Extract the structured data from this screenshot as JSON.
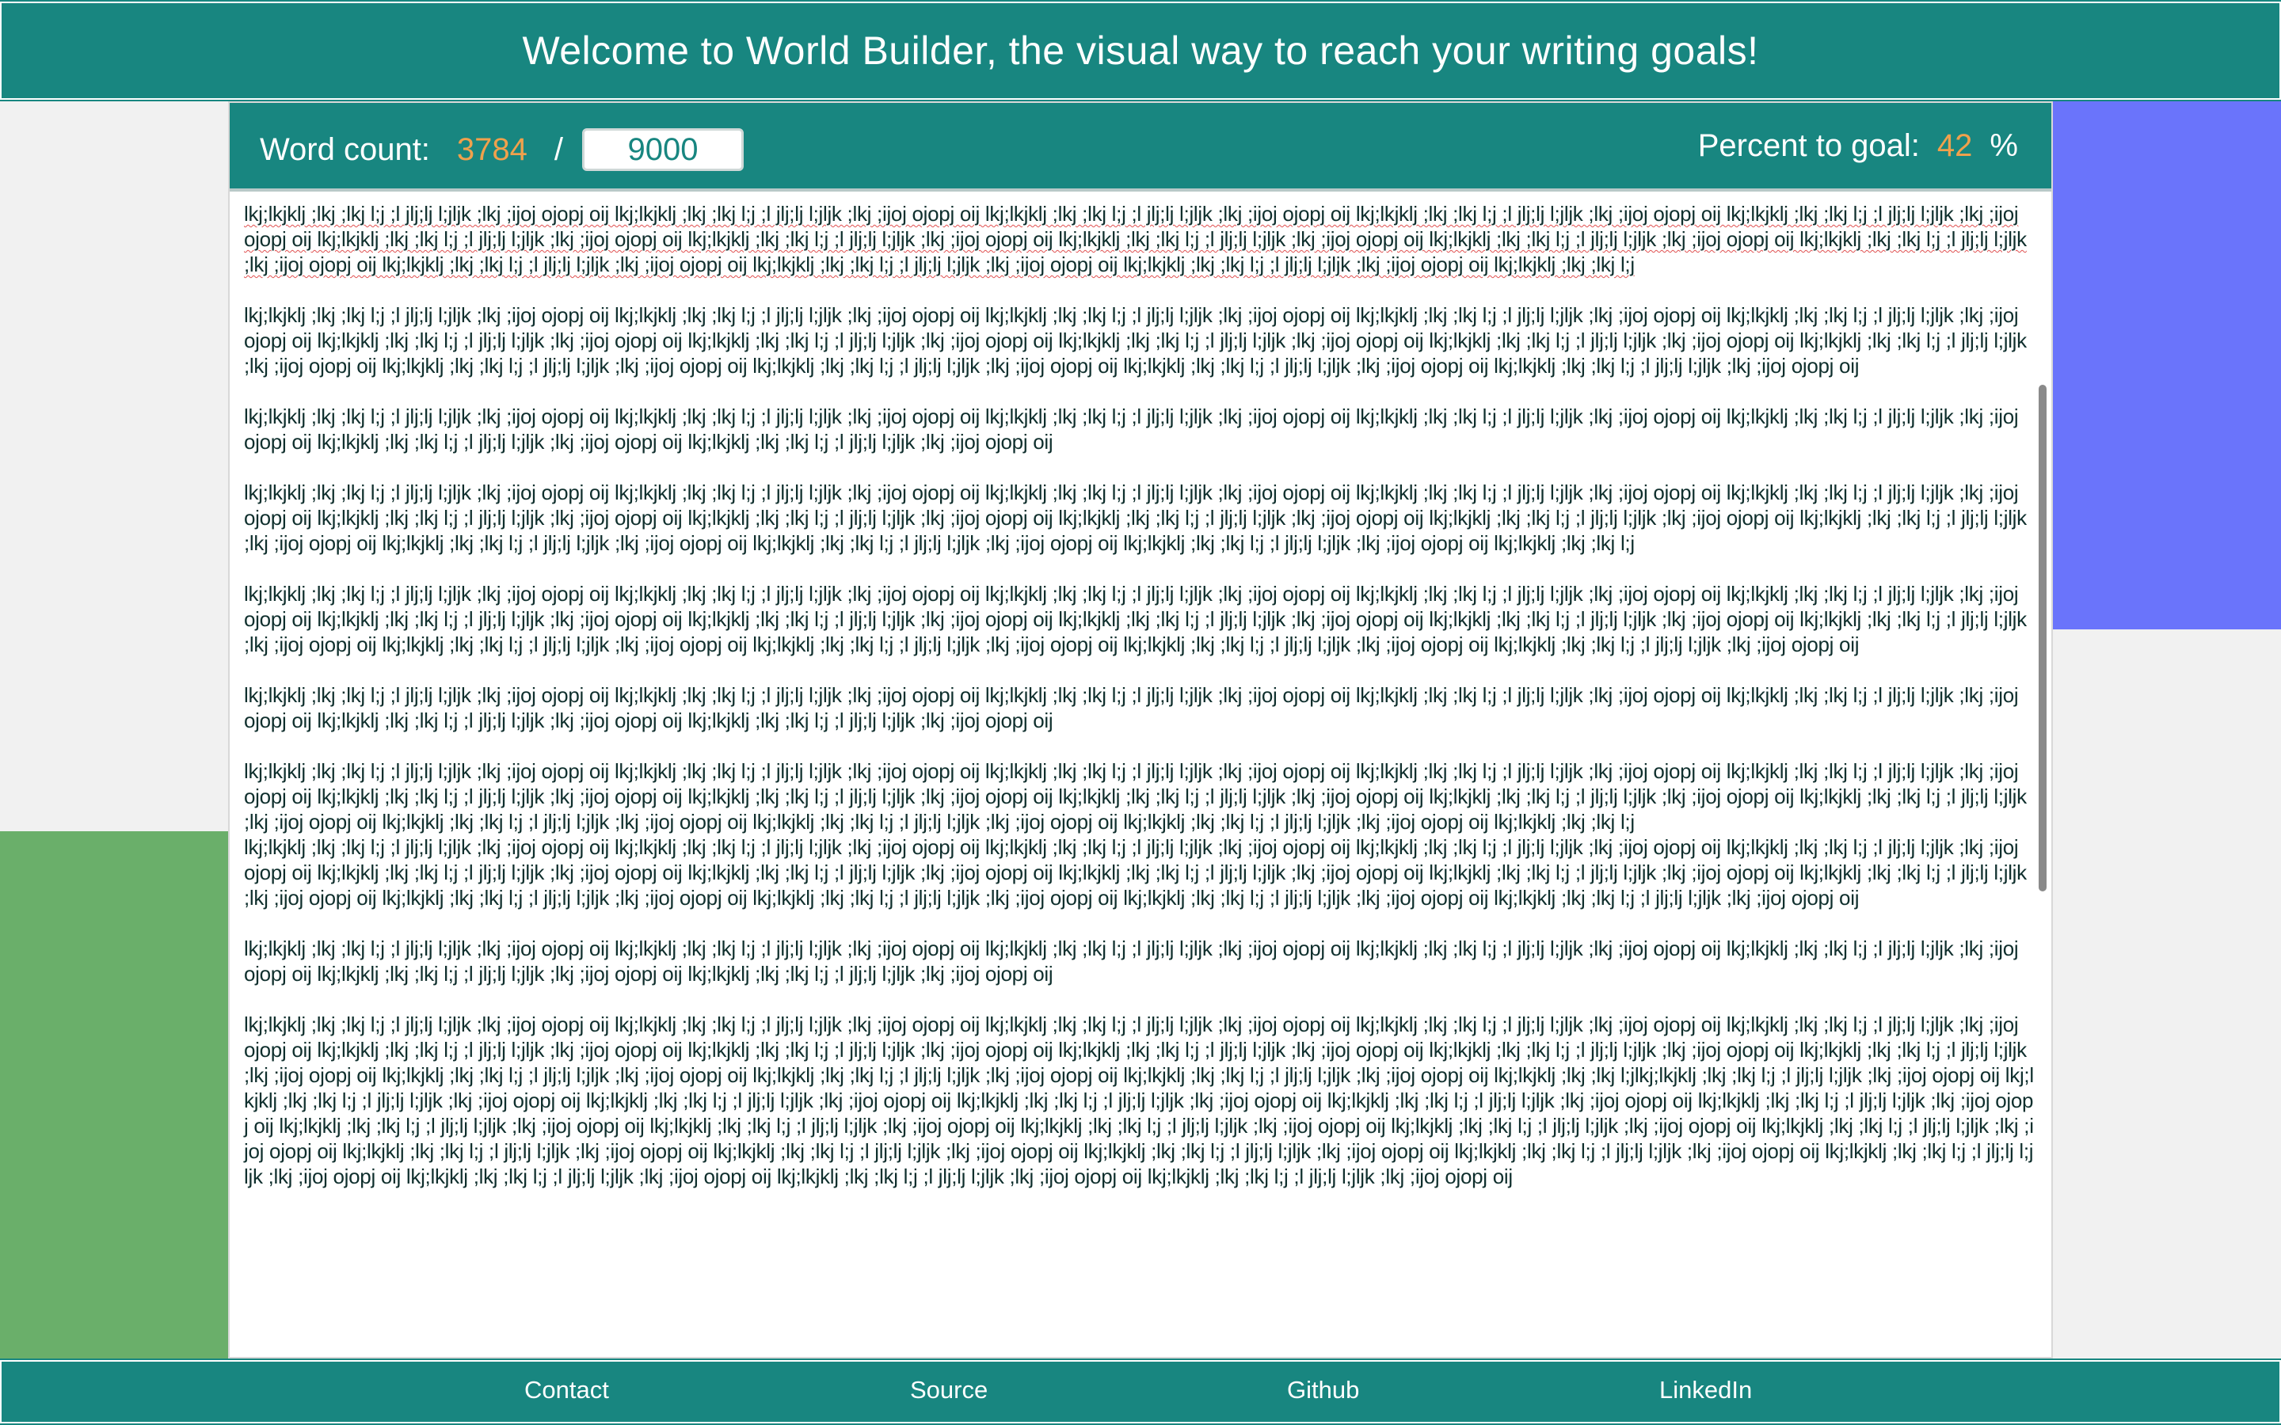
{
  "header": {
    "title": "Welcome to World Builder, the visual way to reach your writing goals!"
  },
  "word_count": {
    "label": "Word count:",
    "current": "3784",
    "separator": "/",
    "goal": "9000",
    "percent_label": "Percent to goal:",
    "percent_value": "42",
    "percent_sign": "%"
  },
  "editor": {
    "paragraphs": [
      "lkj;lkjklj ;lkj ;lkj l;j ;l jlj;lj l;jljk ;lkj ;ijoj ojopj oij lkj;lkjklj ;lkj ;lkj l;j ;l jlj;lj l;jljk ;lkj ;ijoj ojopj oij lkj;lkjklj ;lkj ;lkj l;j ;l jlj;lj l;jljk ;lkj ;ijoj ojopj oij lkj;lkjklj ;lkj ;lkj l;j ;l jlj;lj l;jljk ;lkj ;ijoj ojopj oij lkj;lkjklj ;lkj ;lkj l;j ;l jlj;lj l;jljk ;lkj ;ijoj ojopj oij lkj;lkjklj ;lkj ;lkj l;j ;l jlj;lj l;jljk ;lkj ;ijoj ojopj oij lkj;lkjklj ;lkj ;lkj l;j ;l jlj;lj l;jljk ;lkj ;ijoj ojopj oij lkj;lkjklj ;lkj ;lkj l;j ;l jlj;lj l;jljk ;lkj ;ijoj ojopj oij lkj;lkjklj ;lkj ;lkj l;j ;l jlj;lj l;jljk ;lkj ;ijoj ojopj oij lkj;lkjklj ;lkj ;lkj l;j ;l jlj;lj l;jljk ;lkj ;ijoj ojopj oij lkj;lkjklj ;lkj ;lkj l;j ;l jlj;lj l;jljk ;lkj ;ijoj ojopj oij lkj;lkjklj ;lkj ;lkj l;j ;l jlj;lj l;jljk ;lkj ;ijoj ojopj oij lkj;lkjklj ;lkj ;lkj l;j ;l jlj;lj l;jljk ;lkj ;ijoj ojopj oij lkj;lkjklj ;lkj ;lkj l;j",
      "lkj;lkjklj ;lkj ;lkj l;j ;l jlj;lj l;jljk ;lkj ;ijoj ojopj oij lkj;lkjklj ;lkj ;lkj l;j ;l jlj;lj l;jljk ;lkj ;ijoj ojopj oij lkj;lkjklj ;lkj ;lkj l;j ;l jlj;lj l;jljk ;lkj ;ijoj ojopj oij lkj;lkjklj ;lkj ;lkj l;j ;l jlj;lj l;jljk ;lkj ;ijoj ojopj oij lkj;lkjklj ;lkj ;lkj l;j ;l jlj;lj l;jljk ;lkj ;ijoj ojopj oij lkj;lkjklj ;lkj ;lkj l;j ;l jlj;lj l;jljk ;lkj ;ijoj ojopj oij lkj;lkjklj ;lkj ;lkj l;j ;l jlj;lj l;jljk ;lkj ;ijoj ojopj oij lkj;lkjklj ;lkj ;lkj l;j ;l jlj;lj l;jljk ;lkj ;ijoj ojopj oij lkj;lkjklj ;lkj ;lkj l;j ;l jlj;lj l;jljk ;lkj ;ijoj ojopj oij lkj;lkjklj ;lkj ;lkj l;j ;l jlj;lj l;jljk ;lkj ;ijoj ojopj oij lkj;lkjklj ;lkj ;lkj l;j ;l jlj;lj l;jljk ;lkj ;ijoj ojopj oij lkj;lkjklj ;lkj ;lkj l;j ;l jlj;lj l;jljk ;lkj ;ijoj ojopj oij lkj;lkjklj ;lkj ;lkj l;j ;l jlj;lj l;jljk ;lkj ;ijoj ojopj oij lkj;lkjklj ;lkj ;lkj l;j ;l jlj;lj l;jljk ;lkj ;ijoj ojopj oij",
      "lkj;lkjklj ;lkj ;lkj l;j ;l jlj;lj l;jljk ;lkj ;ijoj ojopj oij lkj;lkjklj ;lkj ;lkj l;j ;l jlj;lj l;jljk ;lkj ;ijoj ojopj oij lkj;lkjklj ;lkj ;lkj l;j ;l jlj;lj l;jljk ;lkj ;ijoj ojopj oij lkj;lkjklj ;lkj ;lkj l;j ;l jlj;lj l;jljk ;lkj ;ijoj ojopj oij lkj;lkjklj ;lkj ;lkj l;j ;l jlj;lj l;jljk ;lkj ;ijoj ojopj oij lkj;lkjklj ;lkj ;lkj l;j ;l jlj;lj l;jljk ;lkj ;ijoj ojopj oij lkj;lkjklj ;lkj ;lkj l;j ;l jlj;lj l;jljk ;lkj ;ijoj ojopj oij",
      "lkj;lkjklj ;lkj ;lkj l;j ;l jlj;lj l;jljk ;lkj ;ijoj ojopj oij lkj;lkjklj ;lkj ;lkj l;j ;l jlj;lj l;jljk ;lkj ;ijoj ojopj oij lkj;lkjklj ;lkj ;lkj l;j ;l jlj;lj l;jljk ;lkj ;ijoj ojopj oij lkj;lkjklj ;lkj ;lkj l;j ;l jlj;lj l;jljk ;lkj ;ijoj ojopj oij lkj;lkjklj ;lkj ;lkj l;j ;l jlj;lj l;jljk ;lkj ;ijoj ojopj oij lkj;lkjklj ;lkj ;lkj l;j ;l jlj;lj l;jljk ;lkj ;ijoj ojopj oij lkj;lkjklj ;lkj ;lkj l;j ;l jlj;lj l;jljk ;lkj ;ijoj ojopj oij lkj;lkjklj ;lkj ;lkj l;j ;l jlj;lj l;jljk ;lkj ;ijoj ojopj oij lkj;lkjklj ;lkj ;lkj l;j ;l jlj;lj l;jljk ;lkj ;ijoj ojopj oij lkj;lkjklj ;lkj ;lkj l;j ;l jlj;lj l;jljk ;lkj ;ijoj ojopj oij lkj;lkjklj ;lkj ;lkj l;j ;l jlj;lj l;jljk ;lkj ;ijoj ojopj oij lkj;lkjklj ;lkj ;lkj l;j ;l jlj;lj l;jljk ;lkj ;ijoj ojopj oij lkj;lkjklj ;lkj ;lkj l;j ;l jlj;lj l;jljk ;lkj ;ijoj ojopj oij lkj;lkjklj ;lkj ;lkj l;j",
      "lkj;lkjklj ;lkj ;lkj l;j ;l jlj;lj l;jljk ;lkj ;ijoj ojopj oij lkj;lkjklj ;lkj ;lkj l;j ;l jlj;lj l;jljk ;lkj ;ijoj ojopj oij lkj;lkjklj ;lkj ;lkj l;j ;l jlj;lj l;jljk ;lkj ;ijoj ojopj oij lkj;lkjklj ;lkj ;lkj l;j ;l jlj;lj l;jljk ;lkj ;ijoj ojopj oij lkj;lkjklj ;lkj ;lkj l;j ;l jlj;lj l;jljk ;lkj ;ijoj ojopj oij lkj;lkjklj ;lkj ;lkj l;j ;l jlj;lj l;jljk ;lkj ;ijoj ojopj oij lkj;lkjklj ;lkj ;lkj l;j ;l jlj;lj l;jljk ;lkj ;ijoj ojopj oij lkj;lkjklj ;lkj ;lkj l;j ;l jlj;lj l;jljk ;lkj ;ijoj ojopj oij lkj;lkjklj ;lkj ;lkj l;j ;l jlj;lj l;jljk ;lkj ;ijoj ojopj oij lkj;lkjklj ;lkj ;lkj l;j ;l jlj;lj l;jljk ;lkj ;ijoj ojopj oij lkj;lkjklj ;lkj ;lkj l;j ;l jlj;lj l;jljk ;lkj ;ijoj ojopj oij lkj;lkjklj ;lkj ;lkj l;j ;l jlj;lj l;jljk ;lkj ;ijoj ojopj oij lkj;lkjklj ;lkj ;lkj l;j ;l jlj;lj l;jljk ;lkj ;ijoj ojopj oij lkj;lkjklj ;lkj ;lkj l;j ;l jlj;lj l;jljk ;lkj ;ijoj ojopj oij",
      "lkj;lkjklj ;lkj ;lkj l;j ;l jlj;lj l;jljk ;lkj ;ijoj ojopj oij lkj;lkjklj ;lkj ;lkj l;j ;l jlj;lj l;jljk ;lkj ;ijoj ojopj oij lkj;lkjklj ;lkj ;lkj l;j ;l jlj;lj l;jljk ;lkj ;ijoj ojopj oij lkj;lkjklj ;lkj ;lkj l;j ;l jlj;lj l;jljk ;lkj ;ijoj ojopj oij lkj;lkjklj ;lkj ;lkj l;j ;l jlj;lj l;jljk ;lkj ;ijoj ojopj oij lkj;lkjklj ;lkj ;lkj l;j ;l jlj;lj l;jljk ;lkj ;ijoj ojopj oij lkj;lkjklj ;lkj ;lkj l;j ;l jlj;lj l;jljk ;lkj ;ijoj ojopj oij",
      "lkj;lkjklj ;lkj ;lkj l;j ;l jlj;lj l;jljk ;lkj ;ijoj ojopj oij lkj;lkjklj ;lkj ;lkj l;j ;l jlj;lj l;jljk ;lkj ;ijoj ojopj oij lkj;lkjklj ;lkj ;lkj l;j ;l jlj;lj l;jljk ;lkj ;ijoj ojopj oij lkj;lkjklj ;lkj ;lkj l;j ;l jlj;lj l;jljk ;lkj ;ijoj ojopj oij lkj;lkjklj ;lkj ;lkj l;j ;l jlj;lj l;jljk ;lkj ;ijoj ojopj oij lkj;lkjklj ;lkj ;lkj l;j ;l jlj;lj l;jljk ;lkj ;ijoj ojopj oij lkj;lkjklj ;lkj ;lkj l;j ;l jlj;lj l;jljk ;lkj ;ijoj ojopj oij lkj;lkjklj ;lkj ;lkj l;j ;l jlj;lj l;jljk ;lkj ;ijoj ojopj oij lkj;lkjklj ;lkj ;lkj l;j ;l jlj;lj l;jljk ;lkj ;ijoj ojopj oij lkj;lkjklj ;lkj ;lkj l;j ;l jlj;lj l;jljk ;lkj ;ijoj ojopj oij lkj;lkjklj ;lkj ;lkj l;j ;l jlj;lj l;jljk ;lkj ;ijoj ojopj oij lkj;lkjklj ;lkj ;lkj l;j ;l jlj;lj l;jljk ;lkj ;ijoj ojopj oij lkj;lkjklj ;lkj ;lkj l;j ;l jlj;lj l;jljk ;lkj ;ijoj ojopj oij lkj;lkjklj ;lkj ;lkj l;j",
      "lkj;lkjklj ;lkj ;lkj l;j ;l jlj;lj l;jljk ;lkj ;ijoj ojopj oij lkj;lkjklj ;lkj ;lkj l;j ;l jlj;lj l;jljk ;lkj ;ijoj ojopj oij lkj;lkjklj ;lkj ;lkj l;j ;l jlj;lj l;jljk ;lkj ;ijoj ojopj oij lkj;lkjklj ;lkj ;lkj l;j ;l jlj;lj l;jljk ;lkj ;ijoj ojopj oij lkj;lkjklj ;lkj ;lkj l;j ;l jlj;lj l;jljk ;lkj ;ijoj ojopj oij lkj;lkjklj ;lkj ;lkj l;j ;l jlj;lj l;jljk ;lkj ;ijoj ojopj oij lkj;lkjklj ;lkj ;lkj l;j ;l jlj;lj l;jljk ;lkj ;ijoj ojopj oij lkj;lkjklj ;lkj ;lkj l;j ;l jlj;lj l;jljk ;lkj ;ijoj ojopj oij lkj;lkjklj ;lkj ;lkj l;j ;l jlj;lj l;jljk ;lkj ;ijoj ojopj oij lkj;lkjklj ;lkj ;lkj l;j ;l jlj;lj l;jljk ;lkj ;ijoj ojopj oij lkj;lkjklj ;lkj ;lkj l;j ;l jlj;lj l;jljk ;lkj ;ijoj ojopj oij lkj;lkjklj ;lkj ;lkj l;j ;l jlj;lj l;jljk ;lkj ;ijoj ojopj oij lkj;lkjklj ;lkj ;lkj l;j ;l jlj;lj l;jljk ;lkj ;ijoj ojopj oij lkj;lkjklj ;lkj ;lkj l;j ;l jlj;lj l;jljk ;lkj ;ijoj ojopj oij",
      "lkj;lkjklj ;lkj ;lkj l;j ;l jlj;lj l;jljk ;lkj ;ijoj ojopj oij lkj;lkjklj ;lkj ;lkj l;j ;l jlj;lj l;jljk ;lkj ;ijoj ojopj oij lkj;lkjklj ;lkj ;lkj l;j ;l jlj;lj l;jljk ;lkj ;ijoj ojopj oij lkj;lkjklj ;lkj ;lkj l;j ;l jlj;lj l;jljk ;lkj ;ijoj ojopj oij lkj;lkjklj ;lkj ;lkj l;j ;l jlj;lj l;jljk ;lkj ;ijoj ojopj oij lkj;lkjklj ;lkj ;lkj l;j ;l jlj;lj l;jljk ;lkj ;ijoj ojopj oij lkj;lkjklj ;lkj ;lkj l;j ;l jlj;lj l;jljk ;lkj ;ijoj ojopj oij",
      "lkj;lkjklj ;lkj ;lkj l;j ;l jlj;lj l;jljk ;lkj ;ijoj ojopj oij lkj;lkjklj ;lkj ;lkj l;j ;l jlj;lj l;jljk ;lkj ;ijoj ojopj oij lkj;lkjklj ;lkj ;lkj l;j ;l jlj;lj l;jljk ;lkj ;ijoj ojopj oij lkj;lkjklj ;lkj ;lkj l;j ;l jlj;lj l;jljk ;lkj ;ijoj ojopj oij lkj;lkjklj ;lkj ;lkj l;j ;l jlj;lj l;jljk ;lkj ;ijoj ojopj oij lkj;lkjklj ;lkj ;lkj l;j ;l jlj;lj l;jljk ;lkj ;ijoj ojopj oij lkj;lkjklj ;lkj ;lkj l;j ;l jlj;lj l;jljk ;lkj ;ijoj ojopj oij lkj;lkjklj ;lkj ;lkj l;j ;l jlj;lj l;jljk ;lkj ;ijoj ojopj oij lkj;lkjklj ;lkj ;lkj l;j ;l jlj;lj l;jljk ;lkj ;ijoj ojopj oij lkj;lkjklj ;lkj ;lkj l;j ;l jlj;lj l;jljk ;lkj ;ijoj ojopj oij lkj;lkjklj ;lkj ;lkj l;j ;l jlj;lj l;jljk ;lkj ;ijoj ojopj oij lkj;lkjklj ;lkj ;lkj l;j ;l jlj;lj l;jljk ;lkj ;ijoj ojopj oij lkj;lkjklj ;lkj ;lkj l;j ;l jlj;lj l;jljk ;lkj ;ijoj ojopj oij lkj;lkjklj ;lkj ;lkj l;jlkj;lkjklj ;lkj ;lkj l;j ;l jlj;lj l;jljk ;lkj ;ijoj ojopj oij lkj;lkjklj ;lkj ;lkj l;j ;l jlj;lj l;jljk ;lkj ;ijoj ojopj oij lkj;lkjklj ;lkj ;lkj l;j ;l jlj;lj l;jljk ;lkj ;ijoj ojopj oij lkj;lkjklj ;lkj ;lkj l;j ;l jlj;lj l;jljk ;lkj ;ijoj ojopj oij lkj;lkjklj ;lkj ;lkj l;j ;l jlj;lj l;jljk ;lkj ;ijoj ojopj oij lkj;lkjklj ;lkj ;lkj l;j ;l jlj;lj l;jljk ;lkj ;ijoj ojopj oij lkj;lkjklj ;lkj ;lkj l;j ;l jlj;lj l;jljk ;lkj ;ijoj ojopj oij lkj;lkjklj ;lkj ;lkj l;j ;l jlj;lj l;jljk ;lkj ;ijoj ojopj oij lkj;lkjklj ;lkj ;lkj l;j ;l jlj;lj l;jljk ;lkj ;ijoj ojopj oij lkj;lkjklj ;lkj ;lkj l;j ;l jlj;lj l;jljk ;lkj ;ijoj ojopj oij lkj;lkjklj ;lkj ;lkj l;j ;l jlj;lj l;jljk ;lkj ;ijoj ojopj oij lkj;lkjklj ;lkj ;lkj l;j ;l jlj;lj l;jljk ;lkj ;ijoj ojopj oij lkj;lkjklj ;lkj ;lkj l;j ;l jlj;lj l;jljk ;lkj ;ijoj ojopj oij lkj;lkjklj ;lkj ;lkj l;j ;l jlj;lj l;jljk ;lkj ;ijoj ojopj oij lkj;lkjklj ;lkj ;lkj l;j ;l jlj;lj l;jljk ;lkj ;ijoj ojopj oij lkj;lkjklj ;lkj ;lkj l;j ;l jlj;lj l;jljk ;lkj ;ijoj ojopj oij lkj;lkjklj ;lkj ;lkj l;j ;l jlj;lj l;jljk ;lkj ;ijoj ojopj oij lkj;lkjklj ;lkj ;lkj l;j ;l jlj;lj l;jljk ;lkj ;ijoj ojopj oij lkj;lkjklj ;lkj ;lkj l;j ;l jlj;lj l;jljk ;lkj ;ijoj ojopj oij"
    ]
  },
  "footer": {
    "links": [
      "Contact",
      "Source",
      "Github",
      "LinkedIn"
    ]
  },
  "colors": {
    "teal": "#188680",
    "orange": "#f0a14c",
    "blue_block": "#6a74fb",
    "green_block": "#6aaf6a"
  }
}
